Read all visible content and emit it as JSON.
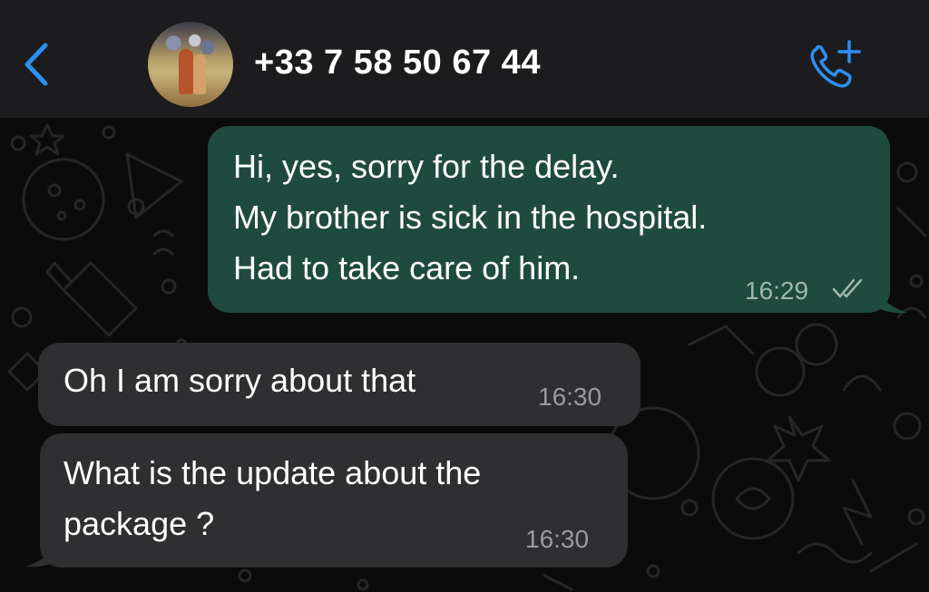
{
  "header": {
    "back_icon": "chevron-left-icon",
    "contact_name": "+33 7 58 50 67 44",
    "call_icon": "phone-plus-icon",
    "accent_color": "#2f8ff0"
  },
  "messages": [
    {
      "direction": "outgoing",
      "text": "Hi, yes, sorry for the delay.\nMy brother is sick in the hospital.\nHad to take care of him.",
      "time": "16:29",
      "status_icon": "double-check-icon",
      "bubble_color": "#1f4b3f"
    },
    {
      "direction": "incoming",
      "text": "Oh I am sorry about that",
      "time": "16:30",
      "bubble_color": "#2f2f31"
    },
    {
      "direction": "incoming",
      "text": "What is the update about the\npackage ?",
      "time": "16:30",
      "bubble_color": "#2f2f31"
    }
  ]
}
